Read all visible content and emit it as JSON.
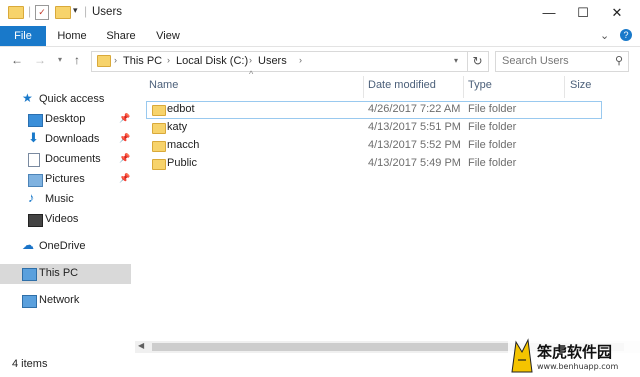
{
  "window": {
    "title": "Users",
    "minimize": "—",
    "maximize": "☐",
    "close": "✕"
  },
  "ribbon": {
    "tabs": [
      "File",
      "Home",
      "Share",
      "View"
    ],
    "expand": "⌄",
    "help": "?"
  },
  "address": {
    "parts": [
      "This PC",
      "Local Disk (C:)",
      "Users"
    ]
  },
  "search": {
    "placeholder": "Search Users"
  },
  "navpane": {
    "quick_access": "Quick access",
    "pinned": [
      "Desktop",
      "Downloads",
      "Documents",
      "Pictures"
    ],
    "unpinned": [
      "Music",
      "Videos"
    ],
    "onedrive": "OneDrive",
    "this_pc": "This PC",
    "network": "Network"
  },
  "columns": {
    "name": "Name",
    "date": "Date modified",
    "type": "Type",
    "size": "Size"
  },
  "files": [
    {
      "name": "edbot",
      "date": "4/26/2017 7:22 AM",
      "type": "File folder"
    },
    {
      "name": "katy",
      "date": "4/13/2017 5:51 PM",
      "type": "File folder"
    },
    {
      "name": "macch",
      "date": "4/13/2017 5:52 PM",
      "type": "File folder"
    },
    {
      "name": "Public",
      "date": "4/13/2017 5:49 PM",
      "type": "File folder"
    }
  ],
  "status": {
    "items": "4 items"
  },
  "colors": {
    "accent": "#1979ca",
    "selected": "#d9d9d9",
    "folder": "#f7d36b"
  },
  "watermark": {
    "brand": "笨虎软件园",
    "url": "www.benhuapp.com"
  }
}
